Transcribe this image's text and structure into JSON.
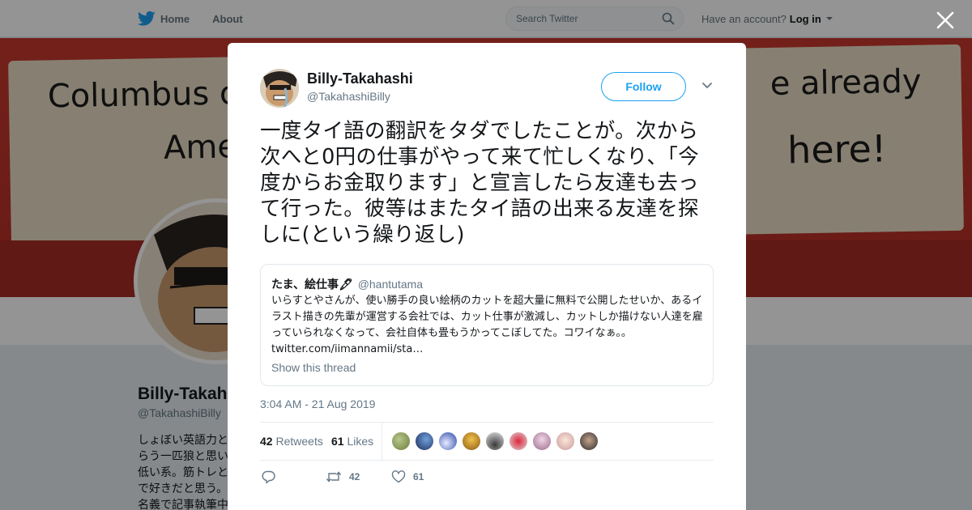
{
  "nav": {
    "home_label": "Home",
    "about_label": "About",
    "search_placeholder": "Search Twitter",
    "account_prompt": "Have an account?",
    "login_label": "Log in"
  },
  "profile": {
    "banner_text": [
      "Columbus c",
      "e already",
      "Ame",
      "here!"
    ],
    "name": "Billy-Takah",
    "handle": "@TakahashiBilly",
    "bio_lines": [
      "しょぼい英語力と",
      "らう一匹狼と思い",
      "低い系。筋トレと",
      "で好きだと思う。",
      "名義で記事執筆中"
    ]
  },
  "tweet": {
    "author_name": "Billy-Takahashi",
    "author_handle": "@TakahashiBilly",
    "follow_label": "Follow",
    "text": "一度タイ語の翻訳をタダでしたことが。次から次へと0円の仕事がやって来て忙しくなり、「今度からお金取ります」と宣言したら友達も去って行った。彼等はまたタイ語の出来る友達を探しに(という繰り返し)",
    "quoted": {
      "name": "たま、絵仕事🖋",
      "handle": "@hantutama",
      "text": "いらすとやさんが、使い勝手の良い絵柄のカットを超大量に無料で公開したせいか、あるイラスト描きの先輩が運営する会社では、カット仕事が激減し、カットしか描けない人達を雇っていられなくなって、会社自体も畳もうかってこぼしてた。コワイなぁ。。",
      "link": "twitter.com/iimannamii/sta…",
      "thread_label": "Show this thread"
    },
    "timestamp": "3:04 AM - 21 Aug 2019",
    "retweets_count": "42",
    "retweets_label": "Retweets",
    "likes_count": "61",
    "likes_label": "Likes",
    "action_retweets": "42",
    "action_likes": "61"
  },
  "colors": {
    "brand": "#1da1f2",
    "text": "#14171a",
    "secondary": "#657786",
    "banner": "#b42f26"
  },
  "icons": [
    "twitter-bird-icon",
    "home-icon",
    "search-icon",
    "close-icon",
    "chevron-down-icon",
    "reply-icon",
    "retweet-icon",
    "like-icon"
  ]
}
